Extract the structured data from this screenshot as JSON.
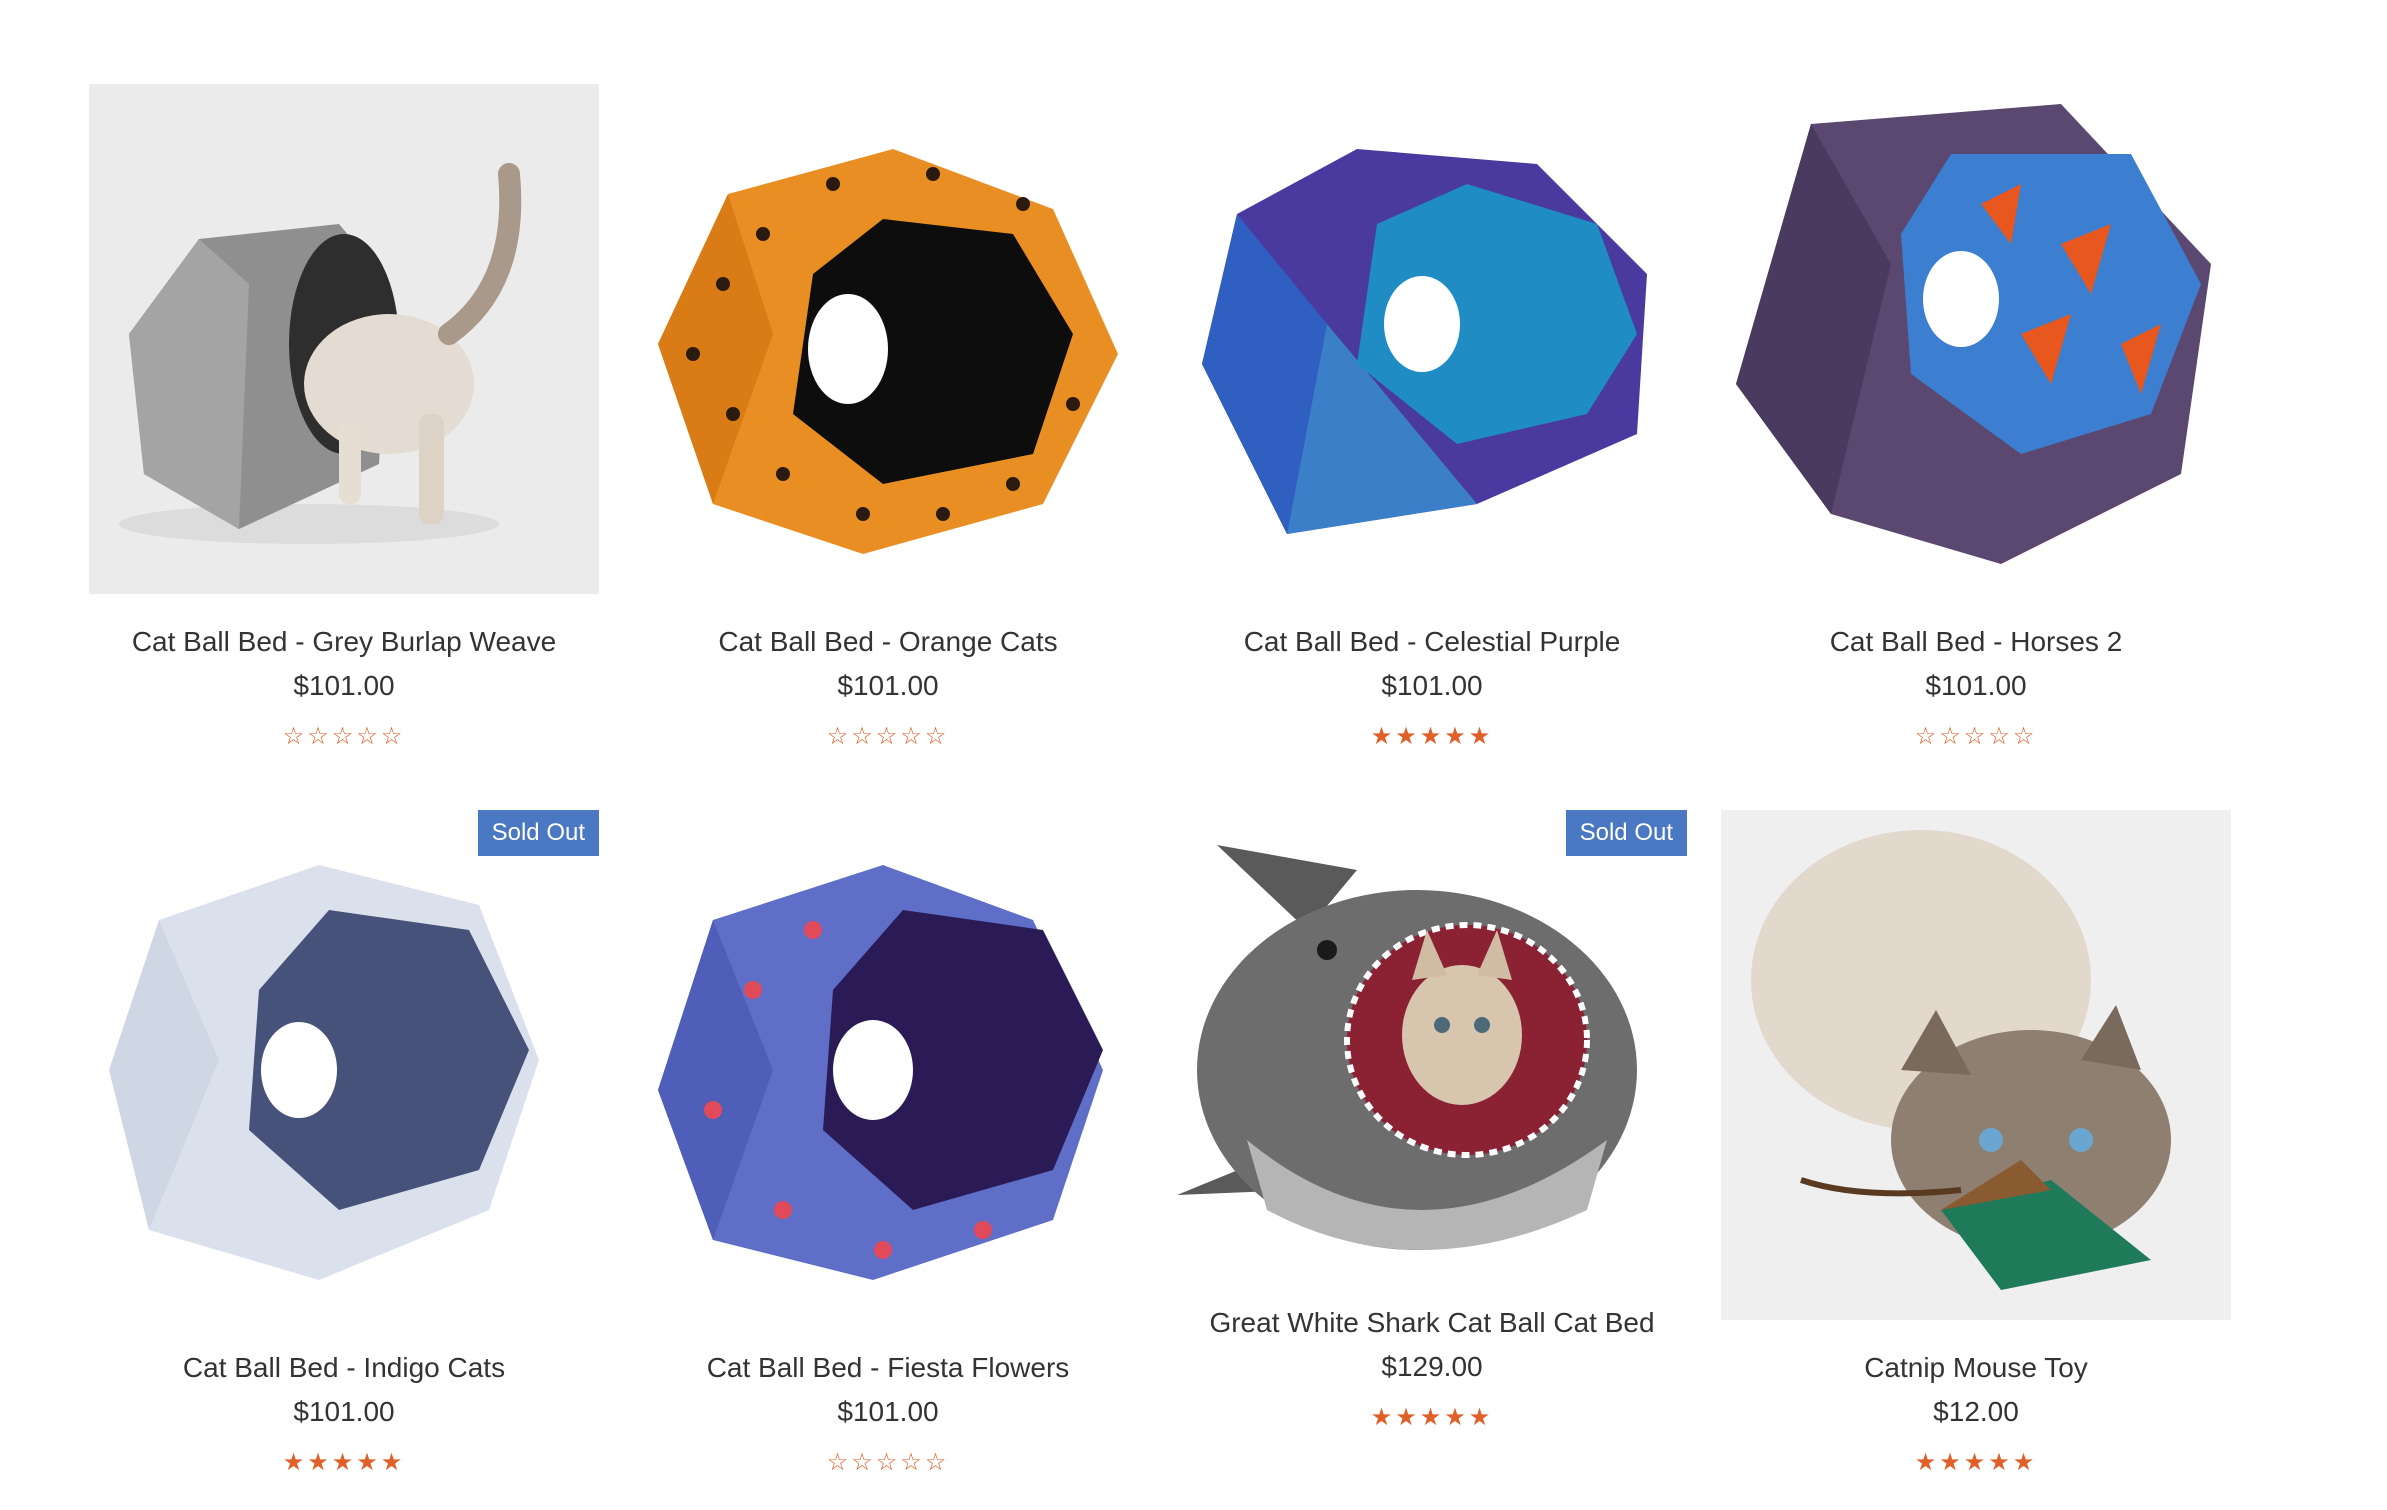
{
  "colors": {
    "badge": "#4a78c2",
    "star": "#e0602a",
    "text": "#333333"
  },
  "products": [
    {
      "title": "Cat Ball Bed - Grey Burlap Weave",
      "price": "$101.00",
      "rating": 0,
      "badge": ""
    },
    {
      "title": "Cat Ball Bed - Orange Cats",
      "price": "$101.00",
      "rating": 0,
      "badge": ""
    },
    {
      "title": "Cat Ball Bed - Celestial Purple",
      "price": "$101.00",
      "rating": 5,
      "badge": ""
    },
    {
      "title": "Cat Ball Bed - Horses 2",
      "price": "$101.00",
      "rating": 0,
      "badge": ""
    },
    {
      "title": "Cat Ball Bed - Indigo Cats",
      "price": "$101.00",
      "rating": 5,
      "badge": "Sold Out"
    },
    {
      "title": "Cat Ball Bed - Fiesta Flowers",
      "price": "$101.00",
      "rating": 0,
      "badge": ""
    },
    {
      "title": "Great White Shark Cat Ball Cat Bed",
      "price": "$129.00",
      "rating": 5,
      "badge": "Sold Out"
    },
    {
      "title": "Catnip Mouse Toy",
      "price": "$12.00",
      "rating": 5,
      "badge": ""
    }
  ]
}
